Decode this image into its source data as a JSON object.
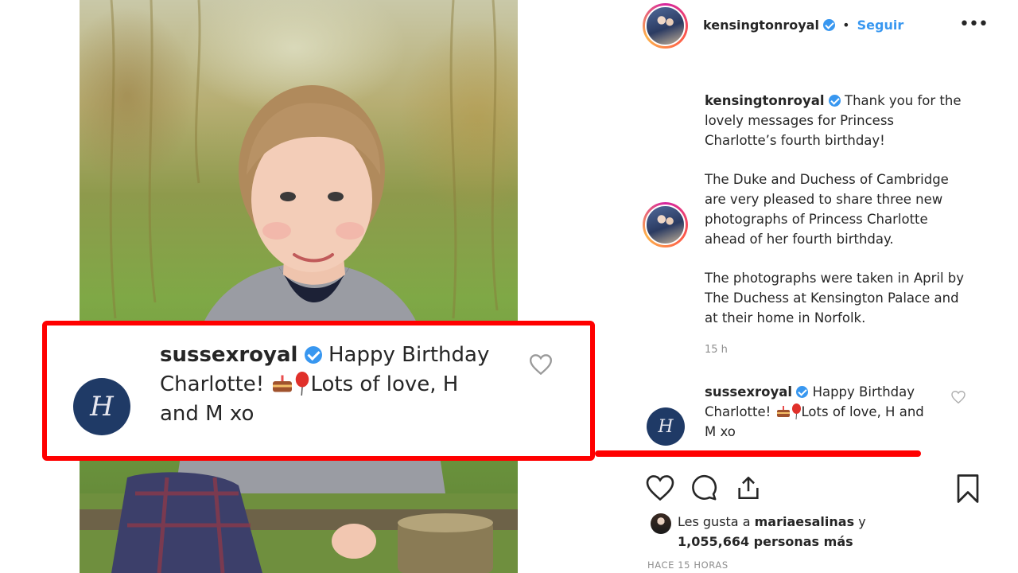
{
  "post": {
    "photo_description_icon": "photo-icon",
    "author": {
      "username": "kensingtonroyal",
      "verified": true,
      "follow_label": "Seguir",
      "more_icon": "more-options-icon"
    },
    "caption": {
      "username": "kensingtonroyal",
      "line1": "Thank you for the lovely messages for Princess Charlotte’s fourth birthday!",
      "line2": "The Duke and Duchess of Cambridge are very pleased to share three new photographs of Princess Charlotte ahead of her fourth birthday.",
      "line3": "The photographs were taken in April by The Duchess at Kensington Palace and at their home in Norfolk.",
      "timestamp": "15 h"
    },
    "comment": {
      "username": "sussexroyal",
      "avatar_letter": "H",
      "text_start": "Happy Birthday Charlotte!",
      "text_end": "Lots of love, H and M xo"
    },
    "actions": {
      "like_icon": "heart-icon",
      "comment_icon": "comment-icon",
      "share_icon": "share-icon",
      "save_icon": "bookmark-icon"
    },
    "likes": {
      "prefix": "Les gusta a",
      "liker": "mariaesalinas",
      "connector": "y",
      "count_text": "1,055,664 personas más"
    },
    "time_ago": "HACE 15 HORAS"
  },
  "colors": {
    "highlight": "#ff0000",
    "link": "#3897f0",
    "text": "#262626",
    "muted": "#8e8e8e",
    "sussex_badge": "#1f3a66"
  }
}
